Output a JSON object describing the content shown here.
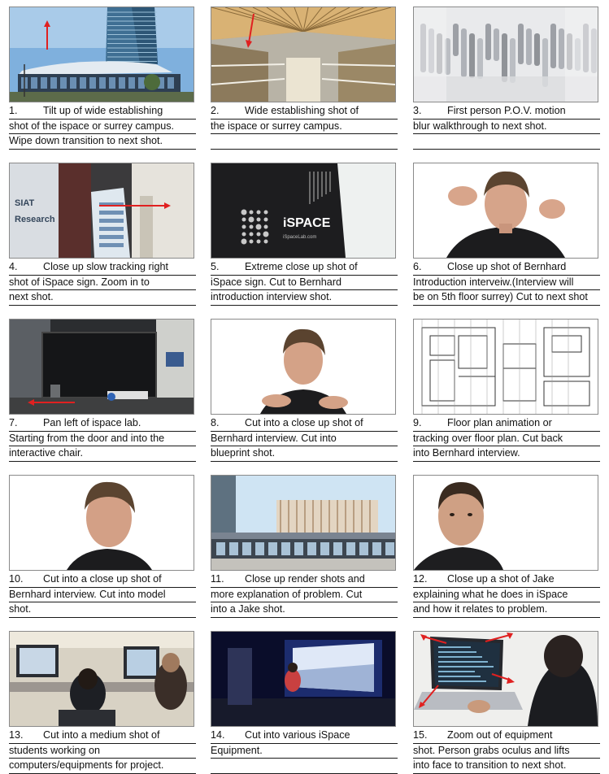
{
  "storyboard": {
    "panels": [
      {
        "id": 1,
        "num": "1.",
        "lines": [
          "Tilt up of wide establishing",
          "shot of the ispace or surrey campus.",
          "Wipe down transition to next shot."
        ],
        "scene": "tower-exterior",
        "arrow": "up"
      },
      {
        "id": 2,
        "num": "2.",
        "lines": [
          "Wide establishing shot of",
          "the ispace or surrey campus.",
          ""
        ],
        "scene": "atrium-interior",
        "arrow": "down"
      },
      {
        "id": 3,
        "num": "3.",
        "lines": [
          "First person P.O.V. motion",
          "blur walkthrough to next shot.",
          ""
        ],
        "scene": "crowd-blur",
        "arrow": ""
      },
      {
        "id": 4,
        "num": "4.",
        "lines": [
          "Close up slow tracking right",
          "shot of iSpace sign. Zoom in to",
          "next shot."
        ],
        "scene": "siat-sign",
        "arrow": "right"
      },
      {
        "id": 5,
        "num": "5.",
        "lines": [
          "Extreme close up shot of",
          "iSpace sign. Cut to Bernhard",
          "introduction interview shot."
        ],
        "scene": "ispace-sign",
        "arrow": ""
      },
      {
        "id": 6,
        "num": "6.",
        "lines": [
          "Close up shot of Bernhard",
          "Introduction interveiw.(Interview will",
          "be on 5th floor surrey) Cut to next shot"
        ],
        "scene": "bernhard-hands",
        "arrow": ""
      },
      {
        "id": 7,
        "num": "7.",
        "lines": [
          "Pan left of ispace lab.",
          "Starting from the door and into the",
          "interactive chair."
        ],
        "scene": "lab-interior",
        "arrow": "left"
      },
      {
        "id": 8,
        "num": "8.",
        "lines": [
          "Cut into a close up shot of",
          "Bernhard interview. Cut into",
          "blueprint shot."
        ],
        "scene": "bernhard-talking",
        "arrow": ""
      },
      {
        "id": 9,
        "num": "9.",
        "lines": [
          "Floor plan animation or",
          "tracking over floor plan. Cut back",
          "into Bernhard interview."
        ],
        "scene": "floor-plan",
        "arrow": ""
      },
      {
        "id": 10,
        "num": "10.",
        "lines": [
          "Cut into a close up shot of",
          "Bernhard interview. Cut into model",
          "shot."
        ],
        "scene": "bernhard-closeup",
        "arrow": ""
      },
      {
        "id": 11,
        "num": "11.",
        "lines": [
          "Close up render shots and",
          "more explanation of problem. Cut",
          "into a Jake shot."
        ],
        "scene": "building-render",
        "arrow": ""
      },
      {
        "id": 12,
        "num": "12.",
        "lines": [
          "Close up a shot of Jake",
          "explaining what he does in iSpace",
          "and how it relates to problem."
        ],
        "scene": "jake-portrait",
        "arrow": ""
      },
      {
        "id": 13,
        "num": "13.",
        "lines": [
          "Cut into a medium shot of",
          "students working on",
          "computers/equipments for project."
        ],
        "scene": "students-computers",
        "arrow": ""
      },
      {
        "id": 14,
        "num": "14.",
        "lines": [
          "Cut into various iSpace",
          "Equipment.",
          ""
        ],
        "scene": "ispace-equipment",
        "arrow": ""
      },
      {
        "id": 15,
        "num": "15.",
        "lines": [
          "Zoom out of equipment",
          "shot. Person grabs oculus and lifts",
          "into face to transition to next shot."
        ],
        "scene": "laptop-user",
        "arrow": "multi"
      }
    ]
  }
}
